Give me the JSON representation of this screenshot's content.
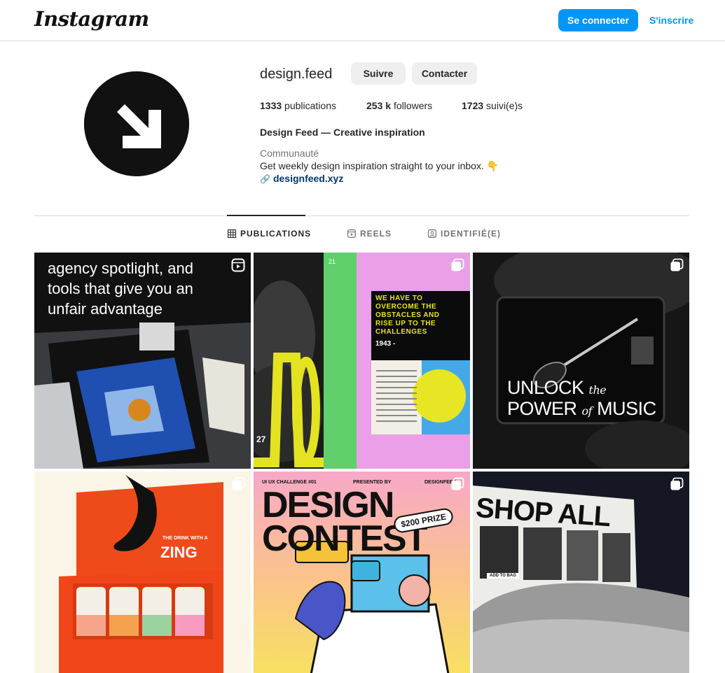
{
  "topbar": {
    "logo": "Instagram",
    "login_label": "Se connecter",
    "signup_label": "S'inscrire"
  },
  "profile": {
    "username": "design.feed",
    "follow_label": "Suivre",
    "contact_label": "Contacter",
    "stats": {
      "posts_value": "1333",
      "posts_label": "publications",
      "followers_value": "253 k",
      "followers_label": "followers",
      "following_value": "1723",
      "following_label": "suivi(e)s"
    },
    "full_name": "Design Feed — Creative inspiration",
    "category": "Communauté",
    "bio": "Get weekly design inspiration straight to your inbox. 👇",
    "link": "designfeed.xyz"
  },
  "tabs": [
    {
      "label": "PUBLICATIONS",
      "icon": "grid-icon",
      "active": true
    },
    {
      "label": "REELS",
      "icon": "reels-icon",
      "active": false
    },
    {
      "label": "IDENTIFIÉ(E)",
      "icon": "tagged-icon",
      "active": false
    }
  ],
  "posts": [
    {
      "type": "reel",
      "icon": "reel-icon",
      "caption_lines": [
        "agency spotlight, and",
        "tools that give you an",
        "unfair advantage"
      ]
    },
    {
      "type": "carousel",
      "icon": "carousel-icon",
      "headline_lines": [
        "WE HAVE TO",
        "OVERCOME THE",
        "OBSTACLES AND",
        "RISE UP TO THE",
        "CHALLENGES"
      ],
      "year": "1943 -",
      "page_top": "21",
      "page_bottom": "27"
    },
    {
      "type": "carousel",
      "icon": "carousel-icon",
      "line1_a": "UNLOCK",
      "line1_b": "the",
      "line2_a": "POWER",
      "line2_b": "of",
      "line2_c": "MUSIC"
    },
    {
      "type": "carousel",
      "icon": "carousel-icon",
      "brand": "ZING",
      "tagline": "THE DRINK WITH A"
    },
    {
      "type": "carousel",
      "icon": "carousel-icon",
      "top_left": "UI UX CHALLENGE #01",
      "top_mid": "PRESENTED BY",
      "top_right": "DESIGNFEED",
      "title_1": "DESIGN",
      "title_2": "CONTEST",
      "prize": "$200 PRIZE"
    },
    {
      "type": "carousel",
      "icon": "carousel-icon",
      "headline": "SHOP ALL",
      "button": "ADD TO BAG"
    }
  ],
  "colors": {
    "accent": "#0095f6",
    "link": "#00376b",
    "muted": "#737373",
    "divider": "#dbdbdb"
  }
}
